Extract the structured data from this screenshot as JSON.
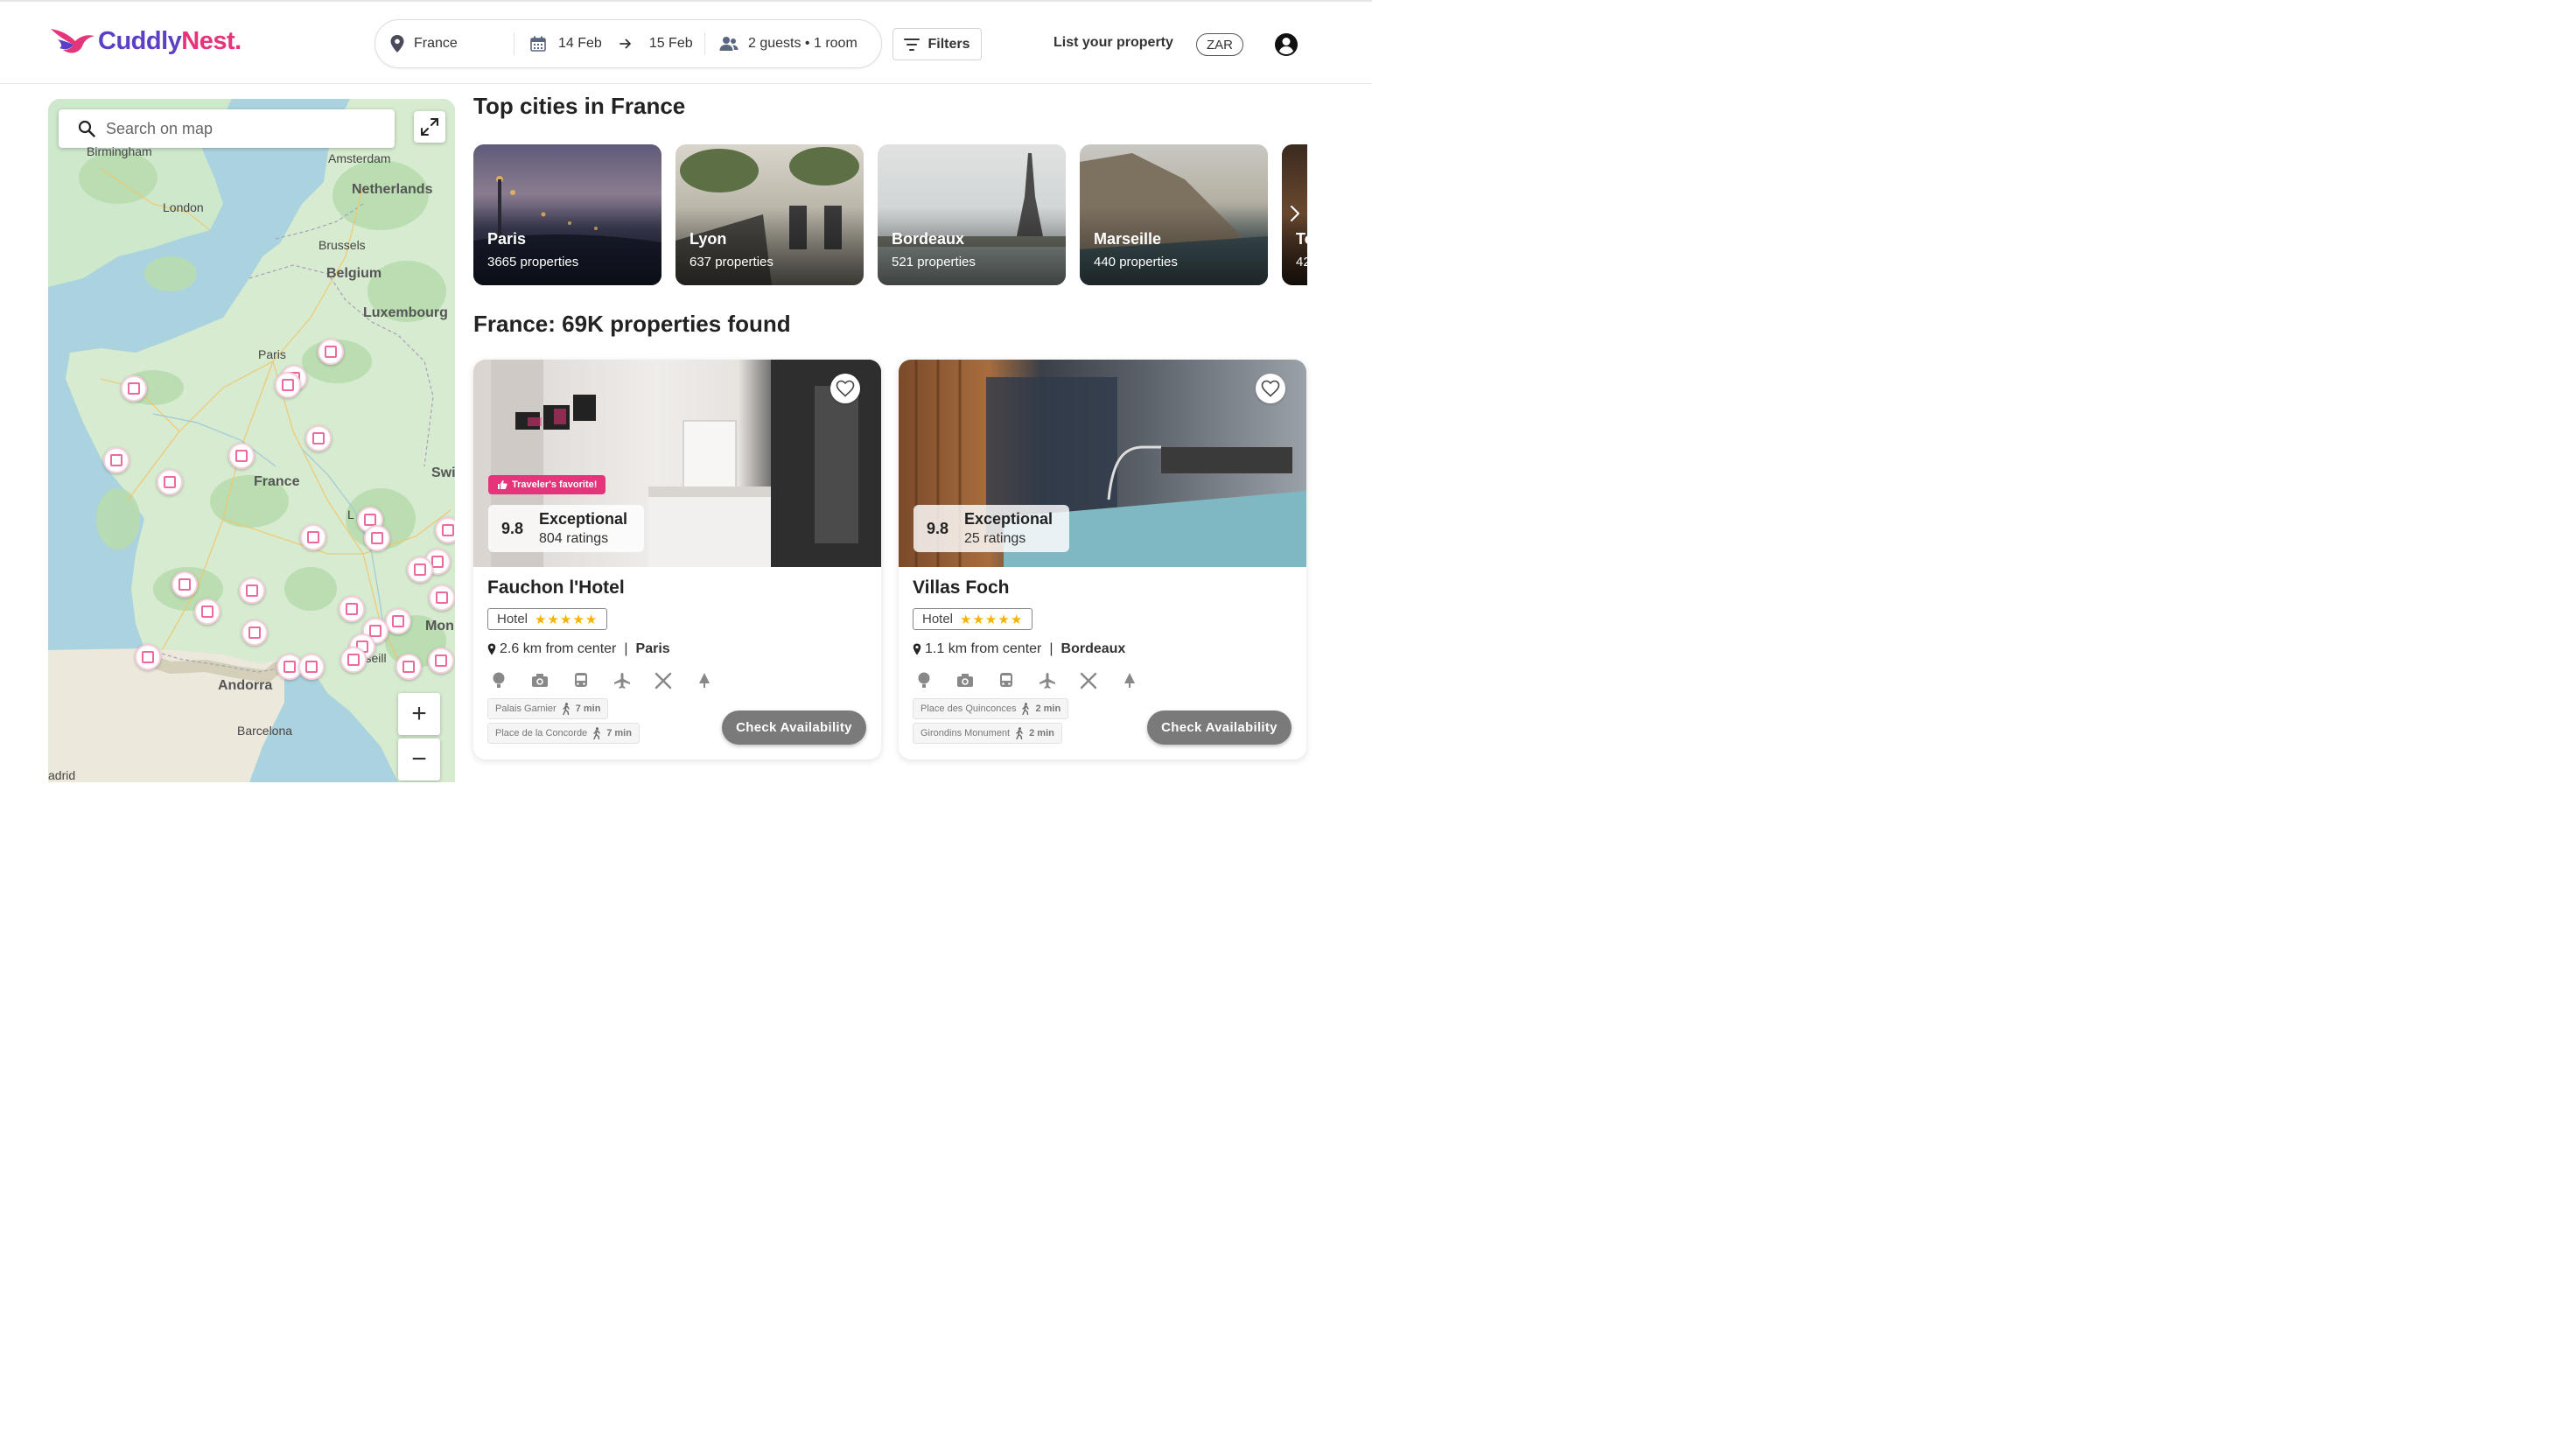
{
  "brand": {
    "name_part1": "Cuddly",
    "name_part2": "Nest.",
    "primary_color": "#5b3fc4",
    "accent_color": "#e5347a"
  },
  "search": {
    "location": "France",
    "checkin": "14 Feb",
    "checkout": "15 Feb",
    "guests": "2 guests • 1 room"
  },
  "header": {
    "filters_label": "Filters",
    "list_property": "List your property",
    "currency": "ZAR"
  },
  "map": {
    "search_placeholder": "Search on map",
    "zoom_in": "+",
    "zoom_out": "−",
    "labels": {
      "birmingham": "Birmingham",
      "amsterdam": "Amsterdam",
      "netherlands": "Netherlands",
      "london": "London",
      "brussels": "Brussels",
      "belgium": "Belgium",
      "luxembourg": "Luxembourg",
      "paris": "Paris",
      "france": "France",
      "swi": "Swi",
      "lyon": "L",
      "mon": "Mon",
      "marseille": "arseill",
      "andorra": "Andorra",
      "barcelona": "Barcelona",
      "madrid": "adrid"
    }
  },
  "top_cities": {
    "title": "Top cities in France",
    "cities": [
      {
        "name": "Paris",
        "count": "3665 properties"
      },
      {
        "name": "Lyon",
        "count": "637 properties"
      },
      {
        "name": "Bordeaux",
        "count": "521 properties"
      },
      {
        "name": "Marseille",
        "count": "440 properties"
      },
      {
        "name": "To",
        "count": "42"
      }
    ]
  },
  "results": {
    "title": "France: 69K properties found",
    "hotels": [
      {
        "name": "Fauchon l'Hotel",
        "badge": "Traveler's favorite!",
        "score": "9.8",
        "rating_label": "Exceptional",
        "ratings_count": "804 ratings",
        "type": "Hotel",
        "stars": "★★★★★",
        "distance": "2.6 km from center",
        "city": "Paris",
        "poi": [
          {
            "name": "Palais Garnier",
            "time": "7 min"
          },
          {
            "name": "Place de la Concorde",
            "time": "7 min"
          }
        ],
        "cta": "Check Availability"
      },
      {
        "name": "Villas Foch",
        "score": "9.8",
        "rating_label": "Exceptional",
        "ratings_count": "25 ratings",
        "type": "Hotel",
        "stars": "★★★★★",
        "distance": "1.1 km from center",
        "city": "Bordeaux",
        "poi": [
          {
            "name": "Place des Quinconces",
            "time": "2 min"
          },
          {
            "name": "Girondins Monument",
            "time": "2 min"
          }
        ],
        "cta": "Check Availability"
      }
    ]
  },
  "separator": "|"
}
